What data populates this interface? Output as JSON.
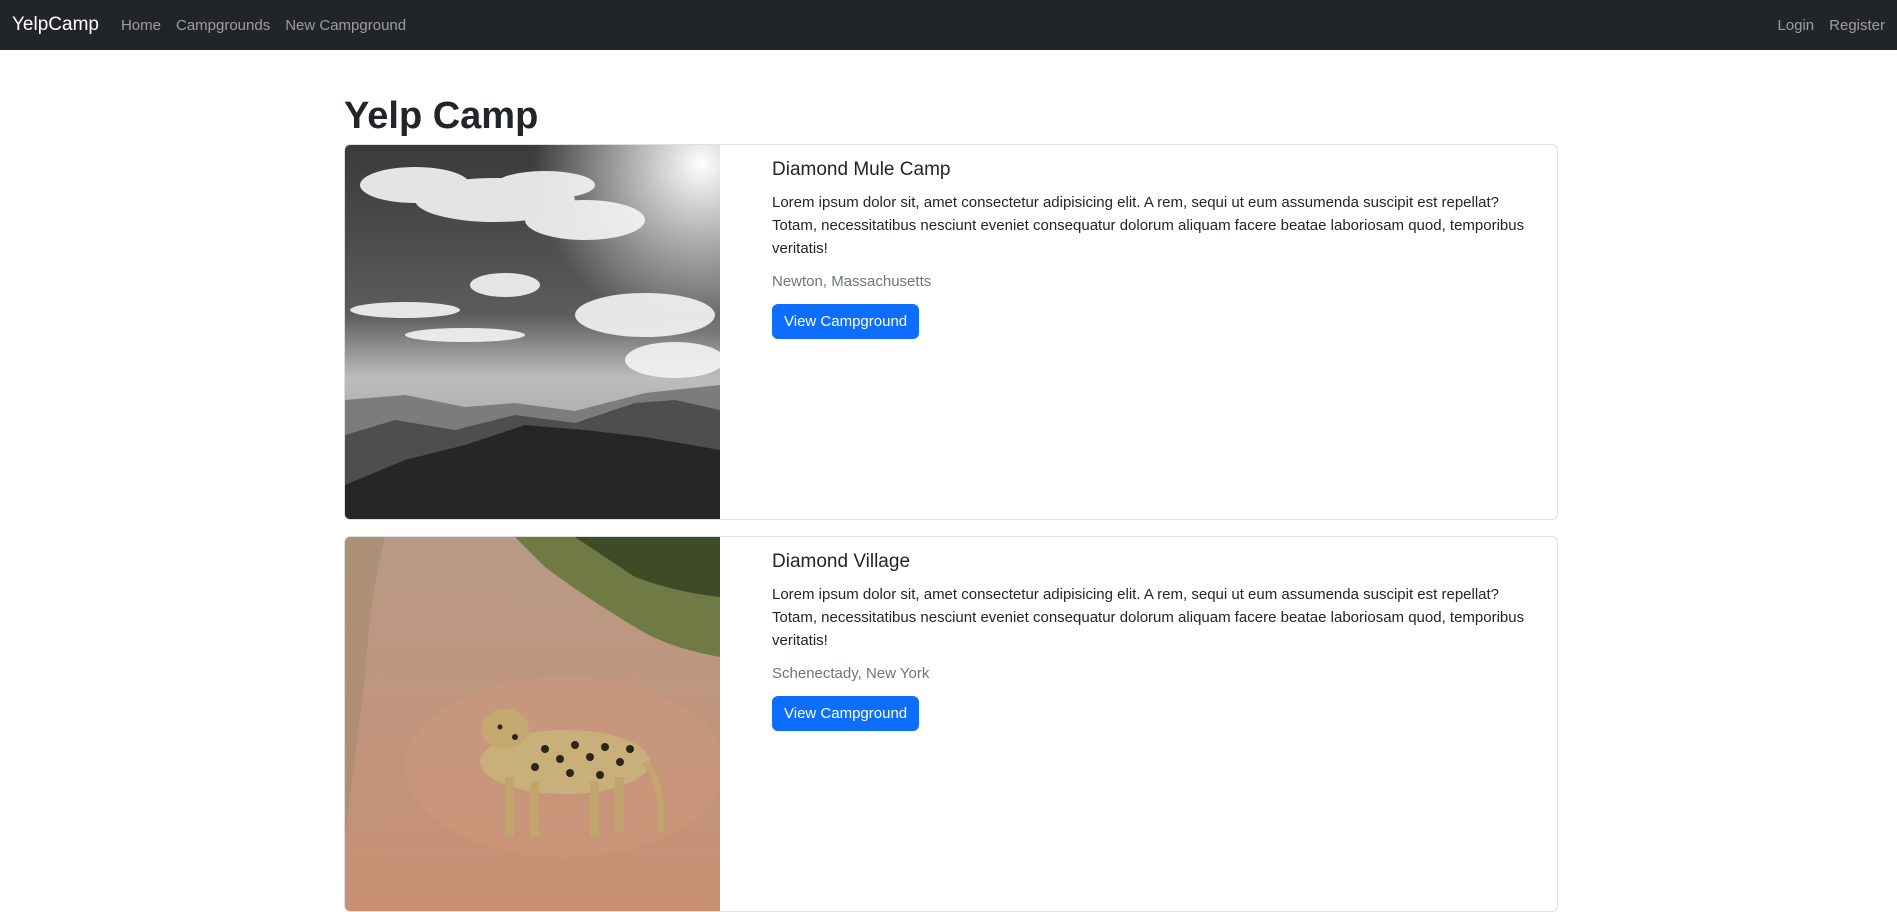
{
  "navbar": {
    "brand": "YelpCamp",
    "links": [
      "Home",
      "Campgrounds",
      "New Campground"
    ],
    "right_links": [
      "Login",
      "Register"
    ]
  },
  "page": {
    "title": "Yelp Camp"
  },
  "campgrounds": [
    {
      "title": "Diamond Mule Camp",
      "description": "Lorem ipsum dolor sit, amet consectetur adipisicing elit. A rem, sequi ut eum assumenda suscipit est repellat? Totam, necessitatibus nesciunt eveniet consequatur dolorum aliquam facere beatae laboriosam quod, temporibus veritatis!",
      "location": "Newton, Massachusetts",
      "button_label": "View Campground",
      "image": "black-and-white-mountain-landscape"
    },
    {
      "title": "Diamond Village",
      "description": "Lorem ipsum dolor sit, amet consectetur adipisicing elit. A rem, sequi ut eum assumenda suscipit est repellat? Totam, necessitatibus nesciunt eveniet consequatur dolorum aliquam facere beatae laboriosam quod, temporibus veritatis!",
      "location": "Schenectady, New York",
      "button_label": "View Campground",
      "image": "leopard-on-dirt-road"
    }
  ],
  "colors": {
    "navbar": "#212529",
    "primary": "#0d6efd",
    "muted": "#6c757d"
  }
}
